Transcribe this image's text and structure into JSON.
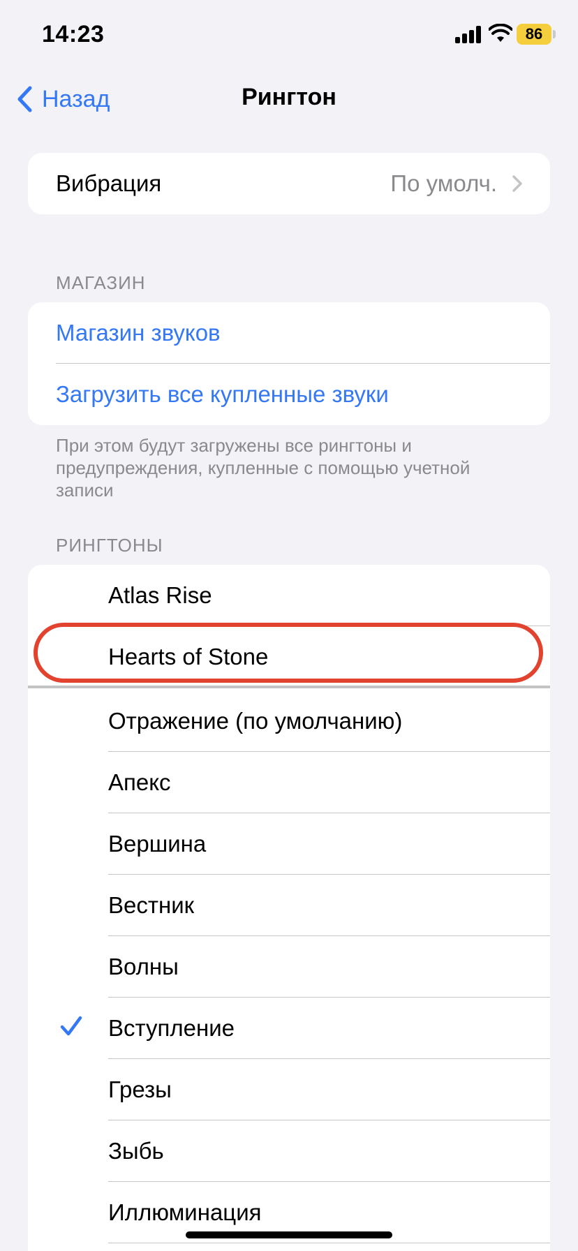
{
  "status": {
    "time": "14:23",
    "battery": "86"
  },
  "nav": {
    "back_label": "Назад",
    "title": "Рингтон"
  },
  "vibration": {
    "label": "Вибрация",
    "value": "По умолч."
  },
  "store": {
    "header": "МАГАЗИН",
    "items": [
      "Магазин звуков",
      "Загрузить все купленные звуки"
    ],
    "footer": "При этом будут загружены все рингтоны и предупреждения, купленные с помощью учетной записи"
  },
  "ringtones": {
    "header": "РИНГТОНЫ",
    "items": [
      {
        "label": "Atlas Rise"
      },
      {
        "label": "Hearts of Stone"
      },
      {
        "label": "Отражение (по умолчанию)"
      },
      {
        "label": "Апекс"
      },
      {
        "label": "Вершина"
      },
      {
        "label": "Вестник"
      },
      {
        "label": "Волны"
      },
      {
        "label": "Вступление",
        "selected": true
      },
      {
        "label": "Грезы"
      },
      {
        "label": "Зыбь"
      },
      {
        "label": "Иллюминация"
      }
    ]
  },
  "colors": {
    "accent": "#3478f6",
    "highlight": "#e2432e",
    "background": "#f2f2f7"
  }
}
